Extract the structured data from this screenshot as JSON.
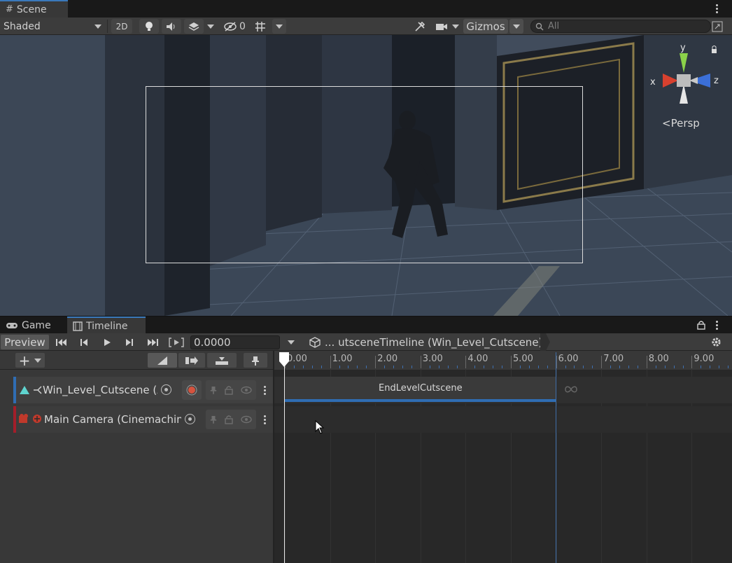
{
  "scene": {
    "tab_label": "Scene",
    "shading_mode": "Shaded",
    "btn_2d": "2D",
    "hidden_count": "0",
    "gizmos_label": "Gizmos",
    "search_placeholder": "All",
    "persp_label": "Persp",
    "axis_x": "x",
    "axis_y": "y",
    "axis_z": "z"
  },
  "bottom_tabs": {
    "game": "Game",
    "timeline": "Timeline"
  },
  "timeline": {
    "preview_label": "Preview",
    "time_value": "0.0000",
    "breadcrumb": "... utsceneTimeline (Win_Level_Cutscene)",
    "ruler_ticks": [
      {
        "label": "0.00",
        "x": 0
      },
      {
        "label": "1.00",
        "x": 1
      },
      {
        "label": "2.00",
        "x": 2
      },
      {
        "label": "3.00",
        "x": 3
      },
      {
        "label": "4.00",
        "x": 4
      },
      {
        "label": "5.00",
        "x": 5
      },
      {
        "label": "6.00",
        "x": 6
      },
      {
        "label": "7.00",
        "x": 7
      },
      {
        "label": "8.00",
        "x": 8
      },
      {
        "label": "9.00",
        "x": 9
      }
    ],
    "tracks": [
      {
        "name": "Win_Level_Cutscene (A",
        "color": "#2f6db3"
      },
      {
        "name": "Main Camera (Cinemachine",
        "color": "#a31e2a"
      }
    ],
    "clip_label": "EndLevelCutscene",
    "clip_start": 0.0,
    "clip_end": 6.0
  },
  "colors": {
    "accent": "#3a79bb",
    "clip_underline": "#2f6db3",
    "track_activation": "#2f6db3",
    "track_animation": "#a31e2a"
  }
}
